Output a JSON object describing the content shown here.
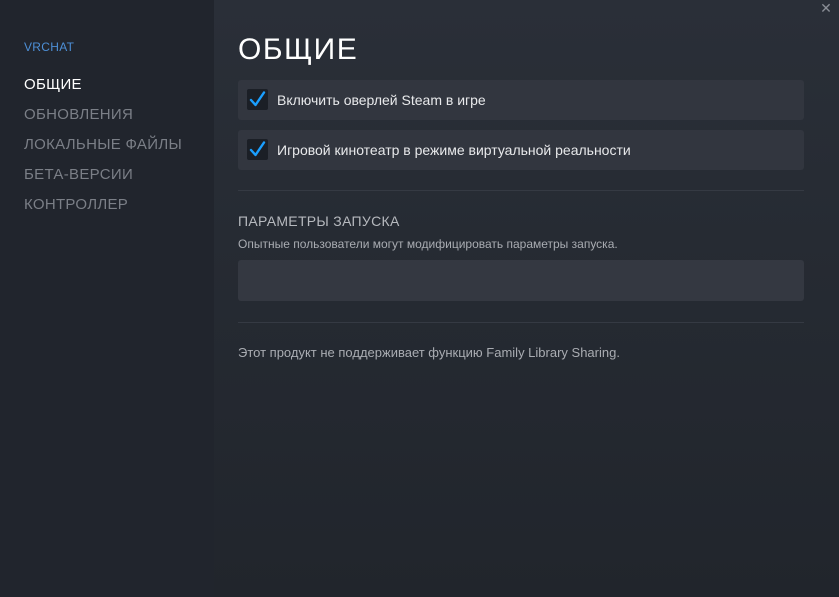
{
  "sidebar": {
    "app_name": "VRCHAT",
    "items": [
      {
        "label": "ОБЩИЕ"
      },
      {
        "label": "ОБНОВЛЕНИЯ"
      },
      {
        "label": "ЛОКАЛЬНЫЕ ФАЙЛЫ"
      },
      {
        "label": "БЕТА-ВЕРСИИ"
      },
      {
        "label": "КОНТРОЛЛЕР"
      }
    ],
    "active_index": 0
  },
  "main": {
    "title": "ОБЩИЕ",
    "options": [
      {
        "label": "Включить оверлей Steam в игре",
        "checked": true
      },
      {
        "label": "Игровой кинотеатр в режиме виртуальной реальности",
        "checked": true
      }
    ],
    "launch": {
      "title": "ПАРАМЕТРЫ ЗАПУСКА",
      "description": "Опытные пользователи могут модифицировать параметры запуска.",
      "value": ""
    },
    "note": "Этот продукт не поддерживает функцию Family Library Sharing."
  },
  "colors": {
    "accent": "#1a9fff",
    "app_name": "#4d8fd6"
  }
}
